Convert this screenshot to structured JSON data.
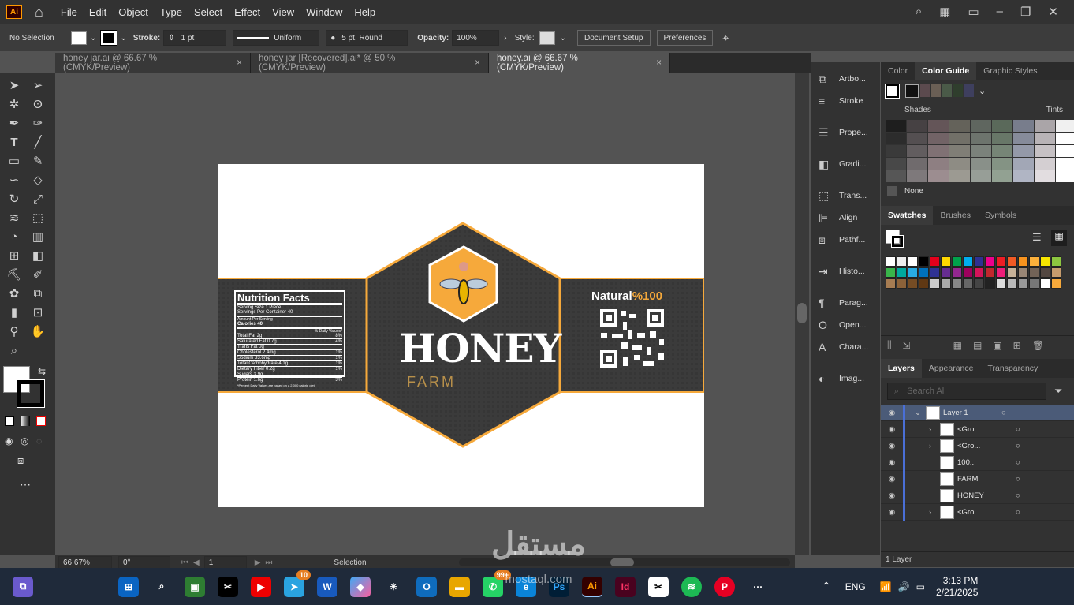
{
  "app_badge": "Ai",
  "menu": [
    "File",
    "Edit",
    "Object",
    "Type",
    "Select",
    "Effect",
    "View",
    "Window",
    "Help"
  ],
  "control": {
    "selection": "No Selection",
    "stroke_label": "Stroke:",
    "stroke_weight": "1 pt",
    "stroke_profile": "Uniform",
    "brush": "5 pt. Round",
    "opacity_label": "Opacity:",
    "opacity": "100%",
    "style_label": "Style:",
    "document_setup": "Document Setup",
    "preferences": "Preferences"
  },
  "tabs": [
    {
      "label": "honey jar.ai @ 66.67 % (CMYK/Preview)"
    },
    {
      "label": "honey jar [Recovered].ai* @ 50 % (CMYK/Preview)"
    },
    {
      "label": "honey.ai @ 66.67 % (CMYK/Preview)"
    }
  ],
  "tab_close": "×",
  "label": {
    "nutrition_title": "Nutrition Facts",
    "serving1": "Serving Size 1 Piece",
    "serving2": "Servings Per Container 40",
    "amount": "Amount Per Serving",
    "calories": "Calories 40",
    "dv_header": "% Daily Values*",
    "rows": [
      {
        "n": "Total Fat 2g",
        "v": "8%"
      },
      {
        "n": "Saturated Fat 0.7g",
        "v": "4%"
      },
      {
        "n": "Trans Fat 0g",
        "v": ""
      },
      {
        "n": "Cholesterol 2.4mg",
        "v": "1%"
      },
      {
        "n": "Sodium 33.6mg",
        "v": "1%"
      },
      {
        "n": "Total Carbohydrate 4.1g",
        "v": "1%"
      },
      {
        "n": "Dietary Fiber 0.2g",
        "v": "1%"
      },
      {
        "n": "Sugars 3.9g",
        "v": ""
      },
      {
        "n": "Protein 1.6g",
        "v": "3%"
      }
    ],
    "footnote": "*Percent Daily Values are based on a 2,000 calorie diet",
    "brand": "HONEY",
    "sub": "FARM",
    "natural": "Natural",
    "pct": "%100"
  },
  "panels": [
    "Artbo...",
    "Stroke",
    "Prope...",
    "Gradi...",
    "Trans...",
    "Align",
    "Pathf...",
    "Histo...",
    "Parag...",
    "Open...",
    "Chara...",
    "Imag..."
  ],
  "colorguide": {
    "tabs": [
      "Color",
      "Color Guide",
      "Graphic Styles"
    ],
    "shades": "Shades",
    "tints": "Tints",
    "none": "None"
  },
  "swatches": {
    "tabs": [
      "Swatches",
      "Brushes",
      "Symbols"
    ]
  },
  "layers": {
    "tabs": [
      "Layers",
      "Appearance",
      "Transparency"
    ],
    "search_placeholder": "Search All",
    "items": [
      "Layer 1",
      "<Gro...",
      "<Gro...",
      "100...",
      "FARM",
      "HONEY",
      "<Gro..."
    ],
    "count": "1 Layer"
  },
  "status": {
    "zoom": "66.67%",
    "rotate": "0°",
    "artboard": "1",
    "tool": "Selection"
  },
  "taskbar": {
    "telegram_badge": "10",
    "whatsapp_badge": "99+",
    "lang": "ENG",
    "time": "3:13 PM",
    "date": "2/21/2025"
  },
  "watermark": "مستقل",
  "watermark_sub": "mostaql.com",
  "colors": {
    "accent": "#f6a93b",
    "label_bg": "#3b3b3b",
    "ui": "#323232"
  }
}
